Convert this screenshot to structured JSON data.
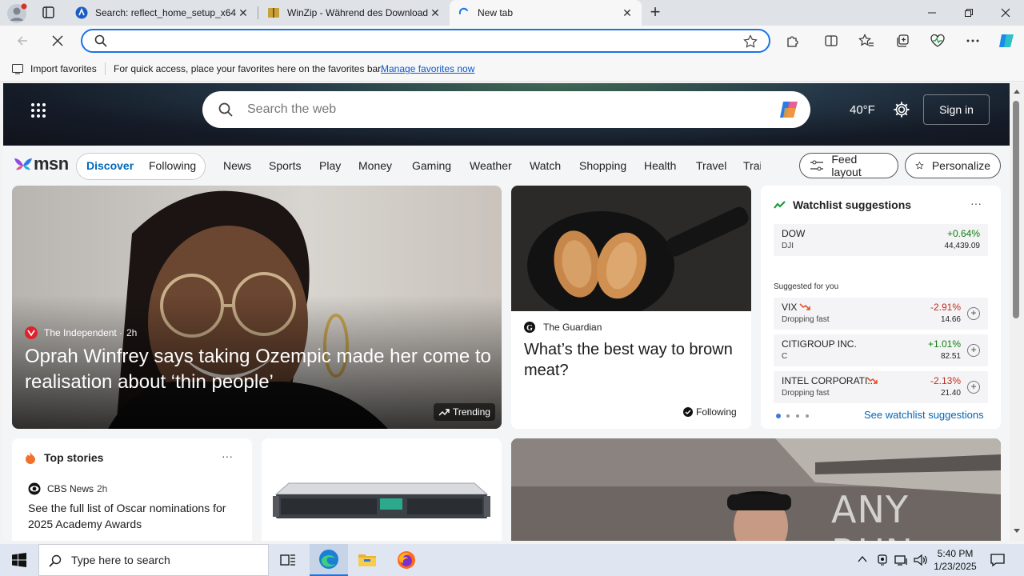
{
  "browser": {
    "tabs": [
      {
        "title": "Search: reflect_home_setup_x64",
        "active": false
      },
      {
        "title": "WinZip - Während des Download",
        "active": false
      },
      {
        "title": "New tab",
        "active": true
      }
    ],
    "new_tab_symbol": "+",
    "address_value": "",
    "favorites_bar": {
      "import_label": "Import favorites",
      "hint": "For quick access, place your favorites here on the favorites bar.",
      "manage_link": "Manage favorites now"
    }
  },
  "msn": {
    "search_placeholder": "Search the web",
    "weather_partial": "n",
    "temperature": "40°F",
    "signin": "Sign in",
    "logo_text": "msn",
    "tabs": [
      "Discover",
      "Following"
    ],
    "nav": [
      "News",
      "Sports",
      "Play",
      "Money",
      "Gaming",
      "Weather",
      "Watch",
      "Shopping",
      "Health",
      "Travel",
      "Trai"
    ],
    "feed_layout": "Feed layout",
    "personalize": "Personalize",
    "hero_story": {
      "source": "The Independent",
      "age": "2h",
      "headline": "Oprah Winfrey says taking Ozempic made her come to realisation about ‘thin people’",
      "badge": "Trending"
    },
    "guardian_story": {
      "source": "The Guardian",
      "headline": "What’s the best way to brown meat?",
      "badge": "Following"
    },
    "watchlist": {
      "title": "Watchlist suggestions",
      "more": "···",
      "top": {
        "symbol": "DOW",
        "sub": "DJI",
        "change": "+0.64%",
        "price": "44,439.09"
      },
      "suggested_label": "Suggested for you",
      "items": [
        {
          "symbol": "VIX",
          "sub": "Dropping fast",
          "change": "-2.91%",
          "price": "14.66",
          "color": "#c42b1c"
        },
        {
          "symbol": "CITIGROUP INC.",
          "sub": "C",
          "change": "+1.01%",
          "price": "82.51",
          "color": "#107c10"
        },
        {
          "symbol": "INTEL CORPORATI...",
          "sub": "Dropping fast",
          "change": "-2.13%",
          "price": "21.40",
          "color": "#c42b1c"
        }
      ],
      "see_link": "See watchlist suggestions"
    },
    "top_stories": {
      "title": "Top stories",
      "more": "···",
      "source": "CBS News",
      "age": "2h",
      "headline": "See the full list of Oscar nominations for 2025 Academy Awards"
    },
    "watermark": "ANY RUN"
  },
  "taskbar": {
    "search_placeholder": "Type here to search",
    "time": "5:40 PM",
    "date": "1/23/2025"
  },
  "colors": {
    "accent": "#1a73e8",
    "down": "#c42b1c",
    "up": "#107c10",
    "msn_link": "#0067b8"
  }
}
